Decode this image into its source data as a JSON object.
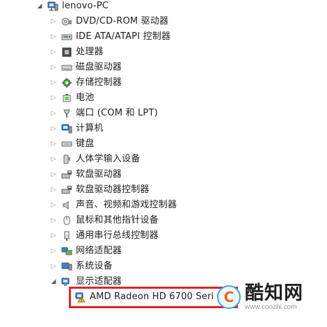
{
  "device_tree": {
    "root": {
      "label": "lenovo-PC",
      "icon": "computer-icon"
    },
    "items": [
      {
        "label": "DVD/CD-ROM 驱动器",
        "icon": "optical-drive-icon"
      },
      {
        "label": "IDE ATA/ATAPI 控制器",
        "icon": "ide-controller-icon"
      },
      {
        "label": "处理器",
        "icon": "processor-icon"
      },
      {
        "label": "磁盘驱动器",
        "icon": "disk-drive-icon"
      },
      {
        "label": "存储控制器",
        "icon": "storage-controller-icon"
      },
      {
        "label": "电池",
        "icon": "battery-icon"
      },
      {
        "label": "端口 (COM 和 LPT)",
        "icon": "port-icon"
      },
      {
        "label": "计算机",
        "icon": "computer-icon"
      },
      {
        "label": "键盘",
        "icon": "keyboard-icon"
      },
      {
        "label": "人体学输入设备",
        "icon": "human-interface-icon"
      },
      {
        "label": "软盘驱动器",
        "icon": "floppy-drive-icon"
      },
      {
        "label": "软盘驱动器控制器",
        "icon": "floppy-controller-icon"
      },
      {
        "label": "声音、视频和游戏控制器",
        "icon": "audio-icon"
      },
      {
        "label": "鼠标和其他指针设备",
        "icon": "mouse-icon"
      },
      {
        "label": "通用串行总线控制器",
        "icon": "usb-controller-icon"
      },
      {
        "label": "网络适配器",
        "icon": "network-adapter-icon"
      },
      {
        "label": "系统设备",
        "icon": "system-devices-icon"
      },
      {
        "label": "显示适配器",
        "icon": "display-adapter-icon",
        "expanded": true
      }
    ],
    "child": {
      "label": "AMD Radeon HD 6700 Seri",
      "icon": "warning-display-adapter-icon"
    }
  },
  "watermark": {
    "name": "酷知网",
    "url": "www.coozhi.com",
    "logo_text": "C"
  },
  "colors": {
    "highlight_border": "#d62828",
    "logo_blue": "#45a5db",
    "logo_orange": "#e36c1d"
  }
}
